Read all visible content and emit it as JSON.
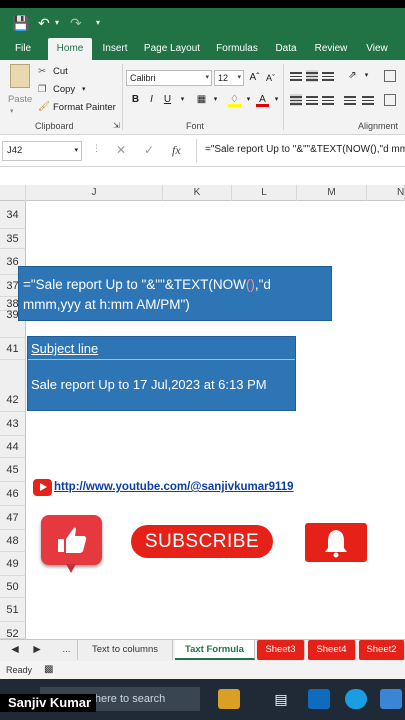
{
  "ribbon_tabs": [
    "File",
    "Home",
    "Insert",
    "Page Layout",
    "Formulas",
    "Data",
    "Review",
    "View"
  ],
  "clipboard": {
    "paste": "Paste",
    "cut": "Cut",
    "copy": "Copy",
    "format_painter": "Format Painter",
    "label": "Clipboard"
  },
  "font": {
    "name": "Calibri",
    "size": "12",
    "label": "Font"
  },
  "alignment": {
    "label": "Alignment"
  },
  "formula_bar": {
    "name_box": "J42",
    "fx": "fx",
    "formula": "=\"Sale report Up to \"&\"\"&TEXT(NOW(),\"d mmm,yyy at h:mm AM/PM\")"
  },
  "columns": [
    "J",
    "K",
    "L",
    "M",
    "N"
  ],
  "rows": [
    "34",
    "35",
    "36",
    "37",
    "38",
    "39",
    "41",
    "42",
    "43",
    "44",
    "45",
    "46",
    "47",
    "48",
    "49",
    "50",
    "51",
    "52"
  ],
  "cells": {
    "formula_line1": "=\"Sale report Up to \"&\"\"&TEXT(NOW",
    "formula_paren": "()",
    "formula_line1_end": ",\"d",
    "formula_line2": "mmm,yyy at h:mm AM/PM\")",
    "subject_header": "Subject line",
    "subject_value": "Sale report Up to 17 Jul,2023 at 6:13 PM"
  },
  "overlay": {
    "url": "http://www.youtube.com/@sanjivkumar9119",
    "subscribe": "SUBSCRIBE"
  },
  "sheet_tabs": [
    "...",
    "Text to columns",
    "Taxt Formula",
    "Sheet3",
    "Sheet4",
    "Sheet2"
  ],
  "status": {
    "ready": "Ready"
  },
  "taskbar": {
    "search_placeholder": "Type here to search"
  },
  "caption": "Sanjiv Kumar",
  "colors": {
    "excel_green": "#217346",
    "selection_blue": "#2e75b6",
    "youtube_red": "#e62117"
  }
}
